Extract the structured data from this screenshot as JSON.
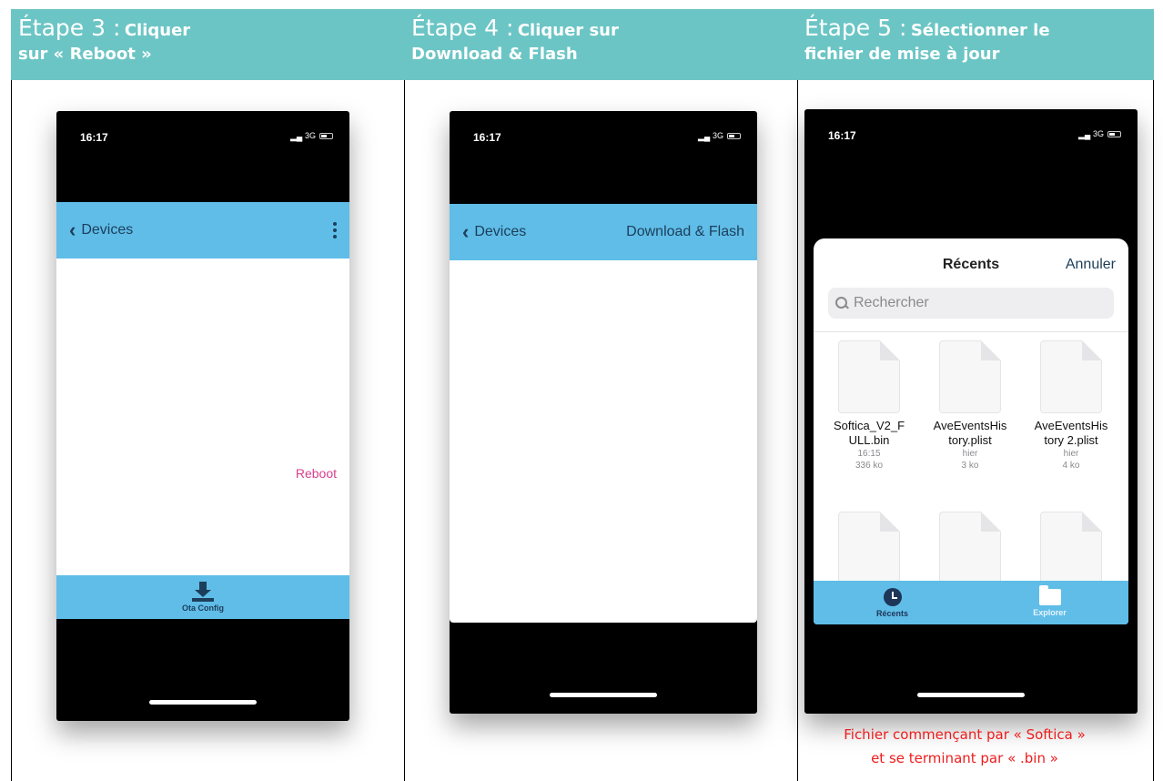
{
  "steps": [
    {
      "step": "Étape 3 :",
      "action": "Cliquer",
      "action_line2": "sur « Reboot »",
      "phone": {
        "time": "16:17",
        "network": "3G",
        "back_label": "Devices",
        "reboot_label": "Reboot",
        "tab_label": "Ota Config",
        "icons": [
          "chevron-left-icon",
          "more-icon",
          "download-icon"
        ]
      }
    },
    {
      "step": "Étape 4 :",
      "action": "Cliquer sur",
      "action_line2": "Download & Flash",
      "phone": {
        "time": "16:17",
        "network": "3G",
        "back_label": "Devices",
        "nav_right": "Download & Flash"
      }
    },
    {
      "step": "Étape 5 :",
      "action": "Sélectionner le",
      "action_line2": "fichier de mise à jour",
      "phone": {
        "time": "16:17",
        "network": "3G",
        "picker_title": "Récents",
        "cancel_label": "Annuler",
        "search_placeholder": "Rechercher",
        "files": [
          {
            "name": "Softica_V2_FULL.bin",
            "line1": "Softica_V2_F",
            "line2": "ULL.bin",
            "date": "16:15",
            "size": "336 ko"
          },
          {
            "name": "AveEventsHistory.plist",
            "line1": "AveEventsHis",
            "line2": "tory.plist",
            "date": "hier",
            "size": "3 ko"
          },
          {
            "name": "AveEventsHistory 2.plist",
            "line1": "AveEventsHis",
            "line2": "tory 2.plist",
            "date": "hier",
            "size": "4 ko"
          }
        ],
        "tabs": [
          "Récents",
          "Explorer"
        ]
      },
      "caption_line1": "Fichier commençant par « Softica »",
      "caption_line2": "et se terminant par « .bin »"
    }
  ],
  "colors": {
    "header_bg": "#6cc5c5",
    "app_bar": "#5fbde8",
    "reboot": "#d8408f",
    "caption": "#ee1c1c"
  }
}
